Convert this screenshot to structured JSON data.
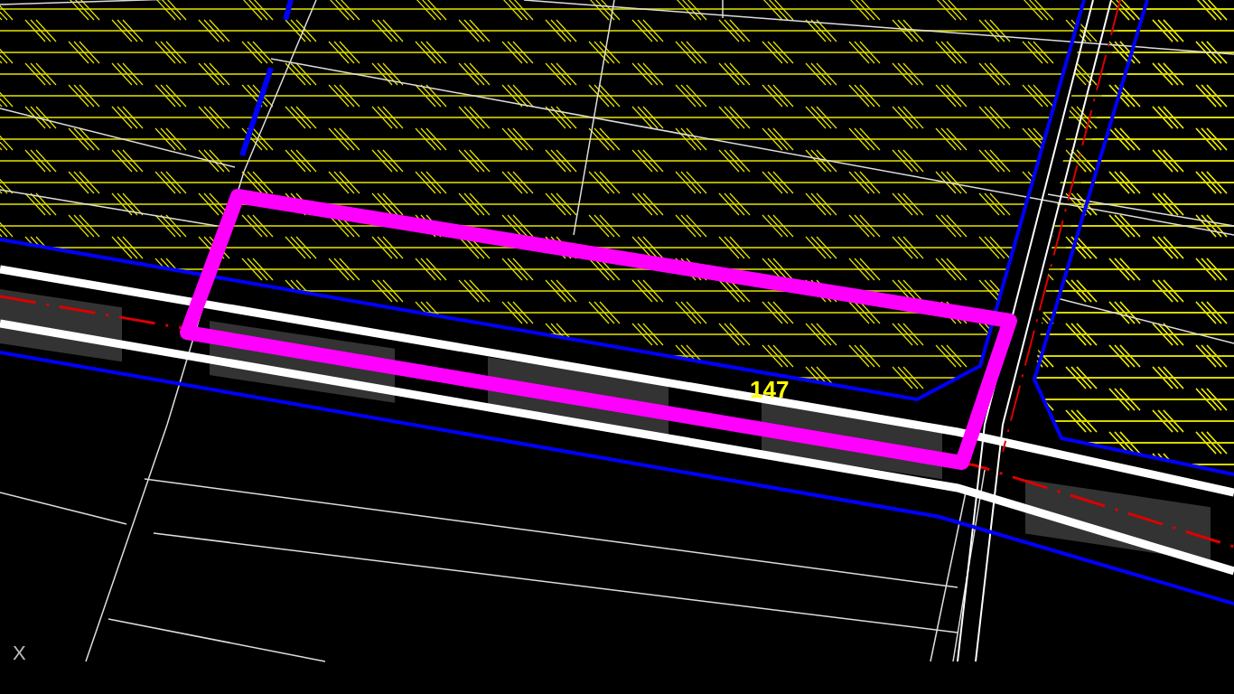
{
  "drawing": {
    "parcel_label": "147",
    "axis_label": "X"
  }
}
